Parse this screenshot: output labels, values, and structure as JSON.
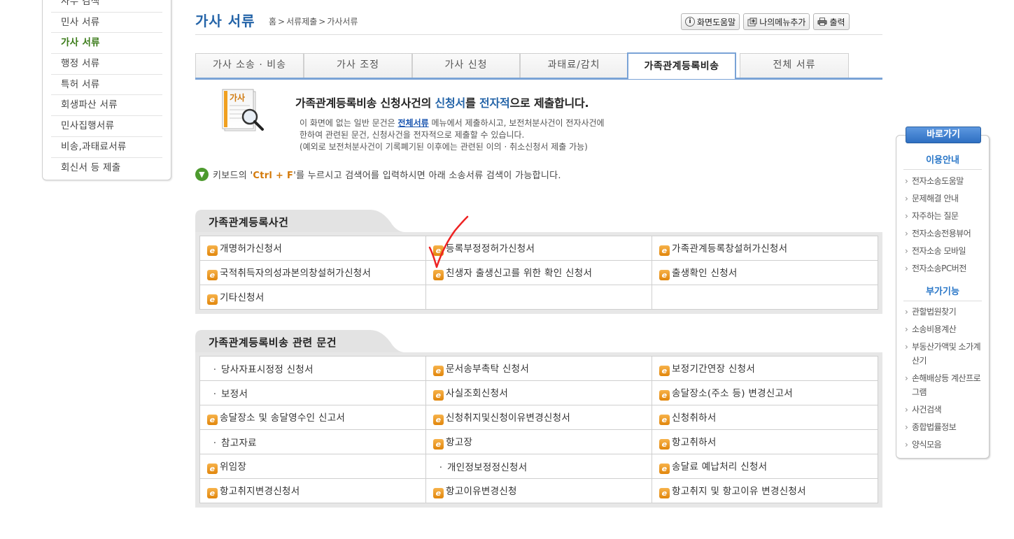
{
  "sidebar": {
    "items": [
      "사무 검색",
      "민사 서류",
      "가사 서류",
      "행정 서류",
      "특허 서류",
      "회생파산 서류",
      "민사집행서류",
      "비송,과태료서류",
      "회신서 등 제출"
    ]
  },
  "header": {
    "title": "가사 서류",
    "breadcrumb": [
      "홈",
      ">",
      "서류제출",
      ">",
      "가사서류"
    ],
    "buttons": {
      "help": "화면도움말",
      "mymenu": "나의메뉴추가",
      "print": "출력"
    }
  },
  "tabs": [
    "가사 소송 · 비송",
    "가사 조정",
    "가사 신청",
    "과태료/감치",
    "가족관계등록비송",
    "전체 서류"
  ],
  "intro": {
    "img_label": "가사",
    "title_a": "가족관계등록비송 신청사건의 ",
    "title_b": "신청서",
    "title_c": "를 ",
    "title_d": "전자적",
    "title_e": "으로 제출합니다.",
    "desc1_a": "이 화면에 없는 일반 문건은 ",
    "desc1_link": "전체서류",
    "desc1_b": " 메뉴에서 제출하시고, 보전처분사건이 전자사건에",
    "desc2": "한하여 관련된 문건, 신청사건을 전자적으로 제출할 수 있습니다.",
    "desc3": "(예외로 보전처분사건이 기록폐기된 이후에는 관련된 이의 · 취소신청서 제출 가능)"
  },
  "notice": {
    "a": "키보드의 '",
    "key": "Ctrl + F",
    "b": "'를 누르시고 검색어를 입력하시면 아래 소송서류 검색이 가능합니다."
  },
  "section1": {
    "title": "가족관계등록사건",
    "rows": [
      [
        {
          "t": "개명허가신청서",
          "e": true
        },
        {
          "t": "등록부정정허가신청서",
          "e": true
        },
        {
          "t": "가족관계등록창설허가신청서",
          "e": true
        }
      ],
      [
        {
          "t": "국적취득자의성과본의창설허가신청서",
          "e": true
        },
        {
          "t": "친생자 출생신고를 위한 확인 신청서",
          "e": true
        },
        {
          "t": "출생확인 신청서",
          "e": true
        }
      ],
      [
        {
          "t": "기타신청서",
          "e": true
        },
        {
          "t": "",
          "e": false
        },
        {
          "t": "",
          "e": false
        }
      ]
    ]
  },
  "section2": {
    "title": "가족관계등록비송 관련 문건",
    "rows": [
      [
        {
          "t": "당사자표시정정 신청서",
          "e": false
        },
        {
          "t": "문서송부촉탁 신청서",
          "e": true
        },
        {
          "t": "보정기간연장 신청서",
          "e": true
        }
      ],
      [
        {
          "t": "보정서",
          "e": false
        },
        {
          "t": "사실조회신청서",
          "e": true
        },
        {
          "t": "송달장소(주소 등) 변경신고서",
          "e": true
        }
      ],
      [
        {
          "t": "송달장소 및 송달영수인 신고서",
          "e": true
        },
        {
          "t": "신청취지및신청이유변경신청서",
          "e": true
        },
        {
          "t": "신청취하서",
          "e": true
        }
      ],
      [
        {
          "t": "참고자료",
          "e": false
        },
        {
          "t": "항고장",
          "e": true
        },
        {
          "t": "항고취하서",
          "e": true
        }
      ],
      [
        {
          "t": "위임장",
          "e": true
        },
        {
          "t": "개인정보정정신청서",
          "e": false
        },
        {
          "t": "송달료 예납처리 신청서",
          "e": true
        }
      ],
      [
        {
          "t": "항고취지변경신청서",
          "e": true
        },
        {
          "t": "항고이유변경신청",
          "e": true
        },
        {
          "t": "항고취지 및 항고이유 변경신청서",
          "e": true
        }
      ]
    ]
  },
  "quick": {
    "head": "바로가기",
    "sec1": "이용안내",
    "list1": [
      "전자소송도움말",
      "문제해결 안내",
      "자주하는 질문",
      "전자소송전용뷰어",
      "전자소송 모바일",
      "전자소송PC버전"
    ],
    "sec2": "부가기능",
    "list2": [
      "관할법원찾기",
      "소송비용계산",
      "부동산가액및 소가계산기",
      "손해배상등 계산프로그램",
      "사건검색",
      "종합법률정보",
      "양식모음"
    ]
  }
}
